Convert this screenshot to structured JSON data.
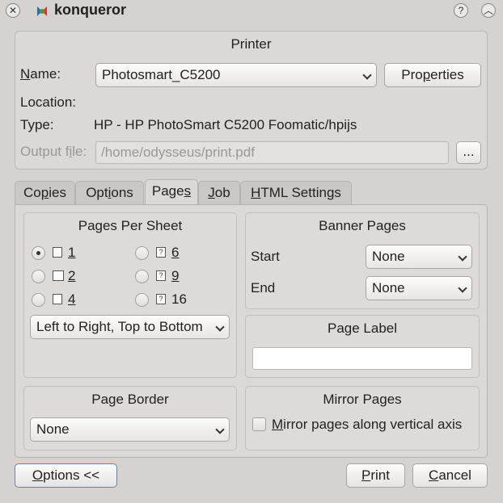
{
  "window": {
    "title": "konqueror",
    "close_icon": "close-icon",
    "help_icon": "help-icon",
    "shade_icon": "chevron-up-icon"
  },
  "printer": {
    "group_title": "Printer",
    "name_label": "Name:",
    "name_value": "Photosmart_C5200",
    "properties_button": "Properties",
    "location_label": "Location:",
    "location_value": "",
    "type_label": "Type:",
    "type_value": "HP - HP PhotoSmart C5200 Foomatic/hpijs",
    "output_label": "Output file:",
    "output_value": "/home/odysseus/print.pdf",
    "browse_button": "..."
  },
  "tabs": [
    {
      "label": "Copies",
      "active": false
    },
    {
      "label": "Options",
      "active": false
    },
    {
      "label": "Pages",
      "active": true
    },
    {
      "label": "Job",
      "active": false
    },
    {
      "label": "HTML Settings",
      "active": false
    }
  ],
  "pages_per_sheet": {
    "title": "Pages Per Sheet",
    "options": [
      "1",
      "2",
      "4",
      "6",
      "9",
      "16"
    ],
    "selected": "1",
    "order_value": "Left to Right, Top to Bottom"
  },
  "banner_pages": {
    "title": "Banner Pages",
    "start_label": "Start",
    "start_value": "None",
    "end_label": "End",
    "end_value": "None"
  },
  "page_label": {
    "title": "Page Label",
    "value": ""
  },
  "page_border": {
    "title": "Page Border",
    "value": "None"
  },
  "mirror_pages": {
    "title": "Mirror Pages",
    "checkbox_label": "Mirror pages along vertical axis",
    "checked": false
  },
  "footer": {
    "options_button": "Options <<",
    "print_button": "Print",
    "cancel_button": "Cancel"
  }
}
